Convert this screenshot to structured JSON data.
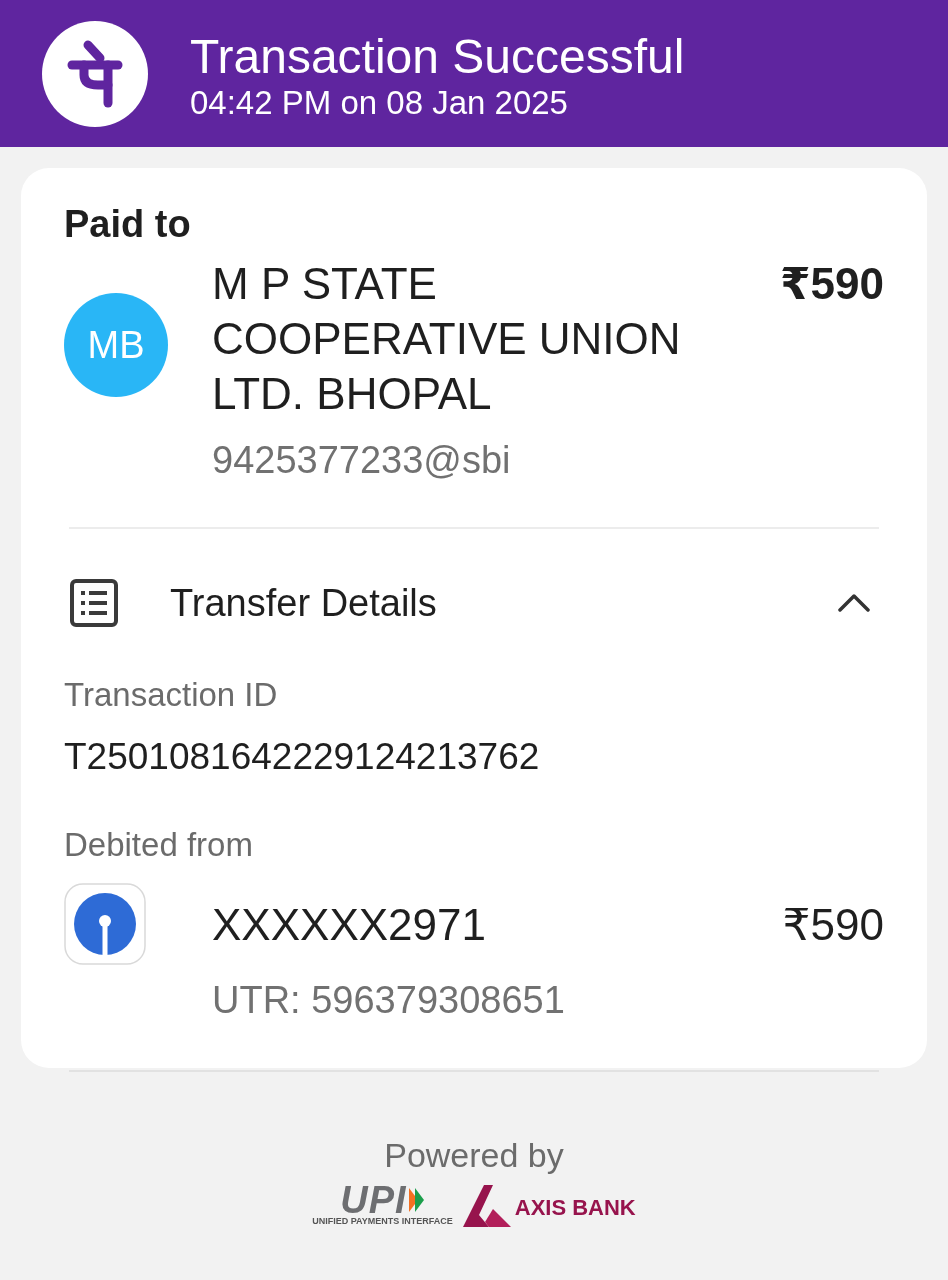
{
  "header": {
    "title": "Transaction Successful",
    "subtitle": "04:42 PM on 08 Jan 2025"
  },
  "payee": {
    "heading": "Paid to",
    "initials": "MB",
    "name": "M P STATE COOPERATIVE UNION LTD. BHOPAL",
    "vpa": "9425377233@sbi",
    "amount": "₹590"
  },
  "transfer_details": {
    "title": "Transfer Details",
    "expanded": true,
    "transaction_id_label": "Transaction ID",
    "transaction_id": "T2501081642229124213762",
    "debited_label": "Debited from",
    "account": "XXXXXX2971",
    "amount": "₹590",
    "utr": "UTR: 596379308651"
  },
  "footer": {
    "powered_by": "Powered by",
    "upi_wordmark": "UPI",
    "upi_tagline": "UNIFIED PAYMENTS INTERFACE",
    "bank_name": "AXIS BANK"
  }
}
